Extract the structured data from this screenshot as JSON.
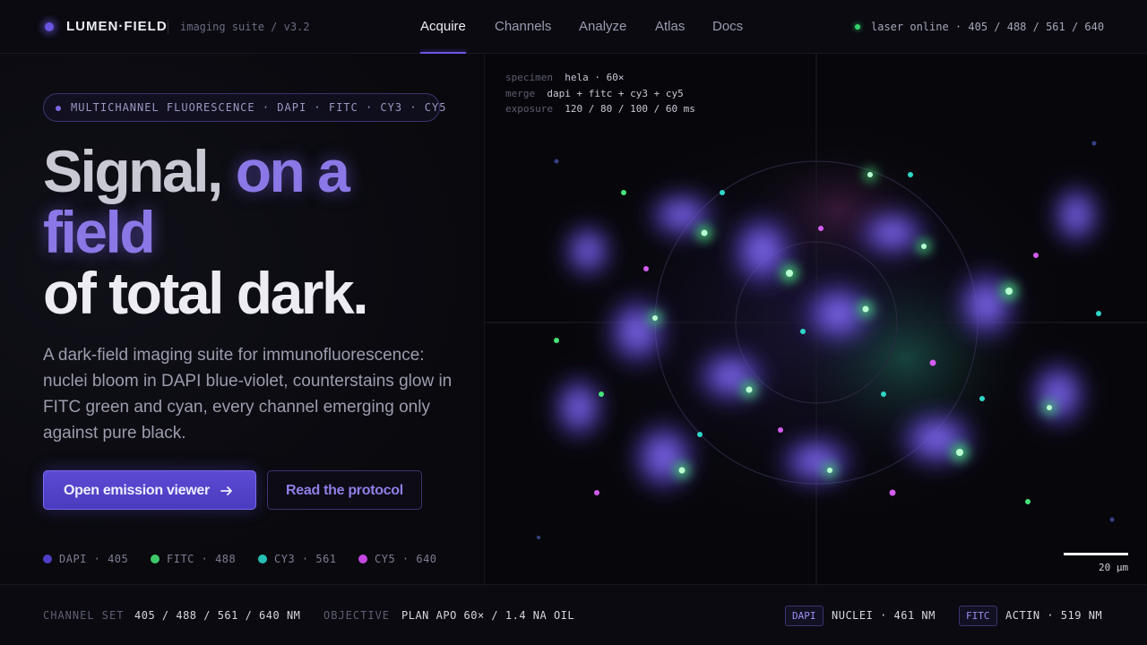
{
  "header": {
    "logo": "LUMEN·FIELD",
    "subtitle": "imaging suite / v3.2",
    "nav": [
      "Acquire",
      "Channels",
      "Analyze",
      "Atlas",
      "Docs"
    ],
    "active_nav": "Acquire",
    "status": "laser online · 405 / 488 / 561 / 640",
    "status_color": "#34d36a"
  },
  "hero": {
    "pill": "MULTICHANNEL FLUORESCENCE · DAPI · FITC · CY3 · CY5",
    "headline_1a": "Signal, ",
    "headline_1b": "on a",
    "headline_2": "field",
    "headline_3": "of total dark.",
    "lede": "A dark-field imaging suite for immunofluorescence: nuclei bloom in DAPI blue-violet, counterstains glow in FITC green and cyan, every channel emerging only against pure black.",
    "primary_button": "Open emission viewer",
    "secondary_button": "Read the protocol",
    "channels": [
      {
        "label": "DAPI · 405",
        "color": "#4f3fc4",
        "icon": "dapi-dot-icon"
      },
      {
        "label": "FITC · 488",
        "color": "#3dc96a",
        "icon": "fitc-dot-icon"
      },
      {
        "label": "CY3 · 561",
        "color": "#25bfb4",
        "icon": "cy3-dot-icon"
      },
      {
        "label": "CY5 · 640",
        "color": "#c447e0",
        "icon": "cy5-dot-icon"
      }
    ]
  },
  "viewer": {
    "meta": [
      {
        "key": "specimen",
        "value": "hela · 60×"
      },
      {
        "key": "merge",
        "value": "dapi + fitc + cy3 + cy5"
      },
      {
        "key": "exposure",
        "value": "120 / 80 / 100 / 60 ms"
      }
    ],
    "scale_label": "20 µm"
  },
  "footer": {
    "channel_set_label": "CHANNEL SET",
    "channel_set_value": "405 / 488 / 561 / 640 NM",
    "objective_label": "OBJECTIVE",
    "objective_value": "PLAN APO 60× / 1.4 NA OIL",
    "tags": [
      {
        "tag": "DAPI",
        "value": "NUCLEI · 461 NM"
      },
      {
        "tag": "FITC",
        "value": "ACTIN · 519 NM"
      }
    ]
  }
}
